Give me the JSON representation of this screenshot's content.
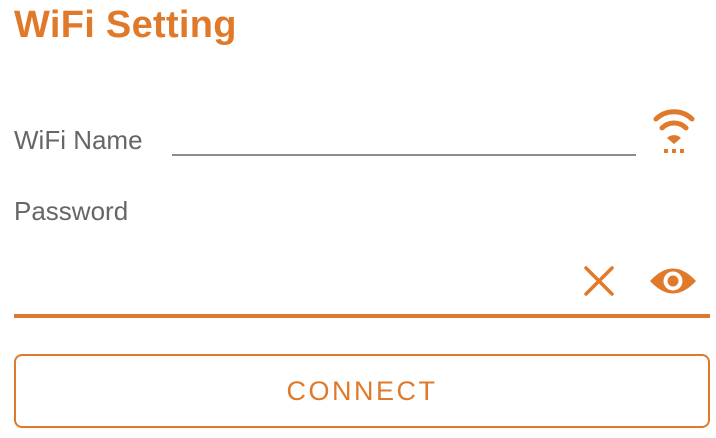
{
  "header": {
    "title": "WiFi Setting"
  },
  "wifi": {
    "label": "WiFi Name",
    "value": "",
    "placeholder": "",
    "icon": "wifi-scan-icon"
  },
  "password": {
    "label": "Password",
    "value": "",
    "placeholder": "",
    "clear_icon": "close-icon",
    "visibility_icon": "eye-icon"
  },
  "actions": {
    "connect_label": "CONNECT"
  },
  "colors": {
    "accent": "#e07a2a",
    "label_text": "#666666",
    "underline_inactive": "#8c8c8c"
  }
}
